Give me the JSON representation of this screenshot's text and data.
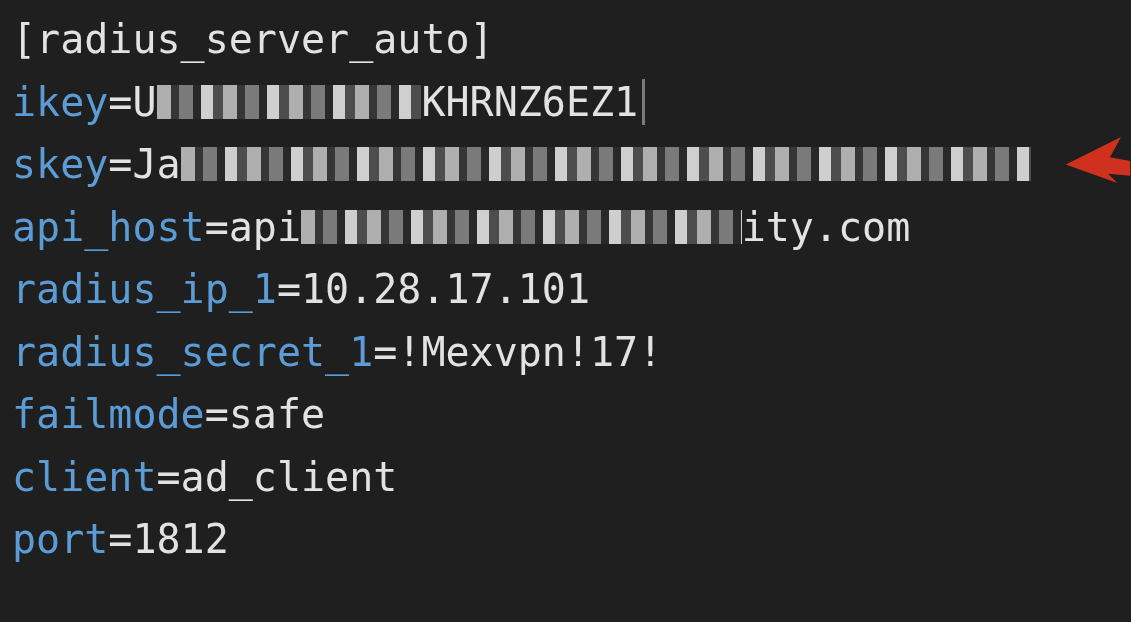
{
  "lines": [
    {
      "kind": "section",
      "text": "[radius_server_auto]",
      "cursor": false
    },
    {
      "kind": "pair",
      "key": "ikey",
      "sep": "=",
      "value": "U",
      "redacted": true,
      "value_end": "KHRNZ6EZ1",
      "cursor": true
    },
    {
      "kind": "pair",
      "key": "skey",
      "sep": "=",
      "value": "Ja",
      "redacted": true,
      "cursor": false
    },
    {
      "kind": "pair",
      "key": "api_host",
      "sep": "=",
      "value": "api",
      "redacted": true,
      "value_end": "ity.com",
      "cursor": false
    },
    {
      "kind": "pair",
      "key": "radius_ip_1",
      "sep": "=",
      "value": "10.28.17.101",
      "redacted": false,
      "cursor": false
    },
    {
      "kind": "pair",
      "key": "radius_secret_1",
      "sep": "=",
      "value": "!Mexvpn!17!",
      "redacted": false,
      "cursor": false
    },
    {
      "kind": "pair",
      "key": "failmode",
      "sep": "=",
      "value": "safe",
      "redacted": false,
      "cursor": false
    },
    {
      "kind": "pair",
      "key": "client",
      "sep": "=",
      "value": "ad_client",
      "redacted": false,
      "cursor": false
    },
    {
      "kind": "pair",
      "key": "port",
      "sep": "=",
      "value": "1812",
      "redacted": false,
      "cursor": false
    }
  ]
}
